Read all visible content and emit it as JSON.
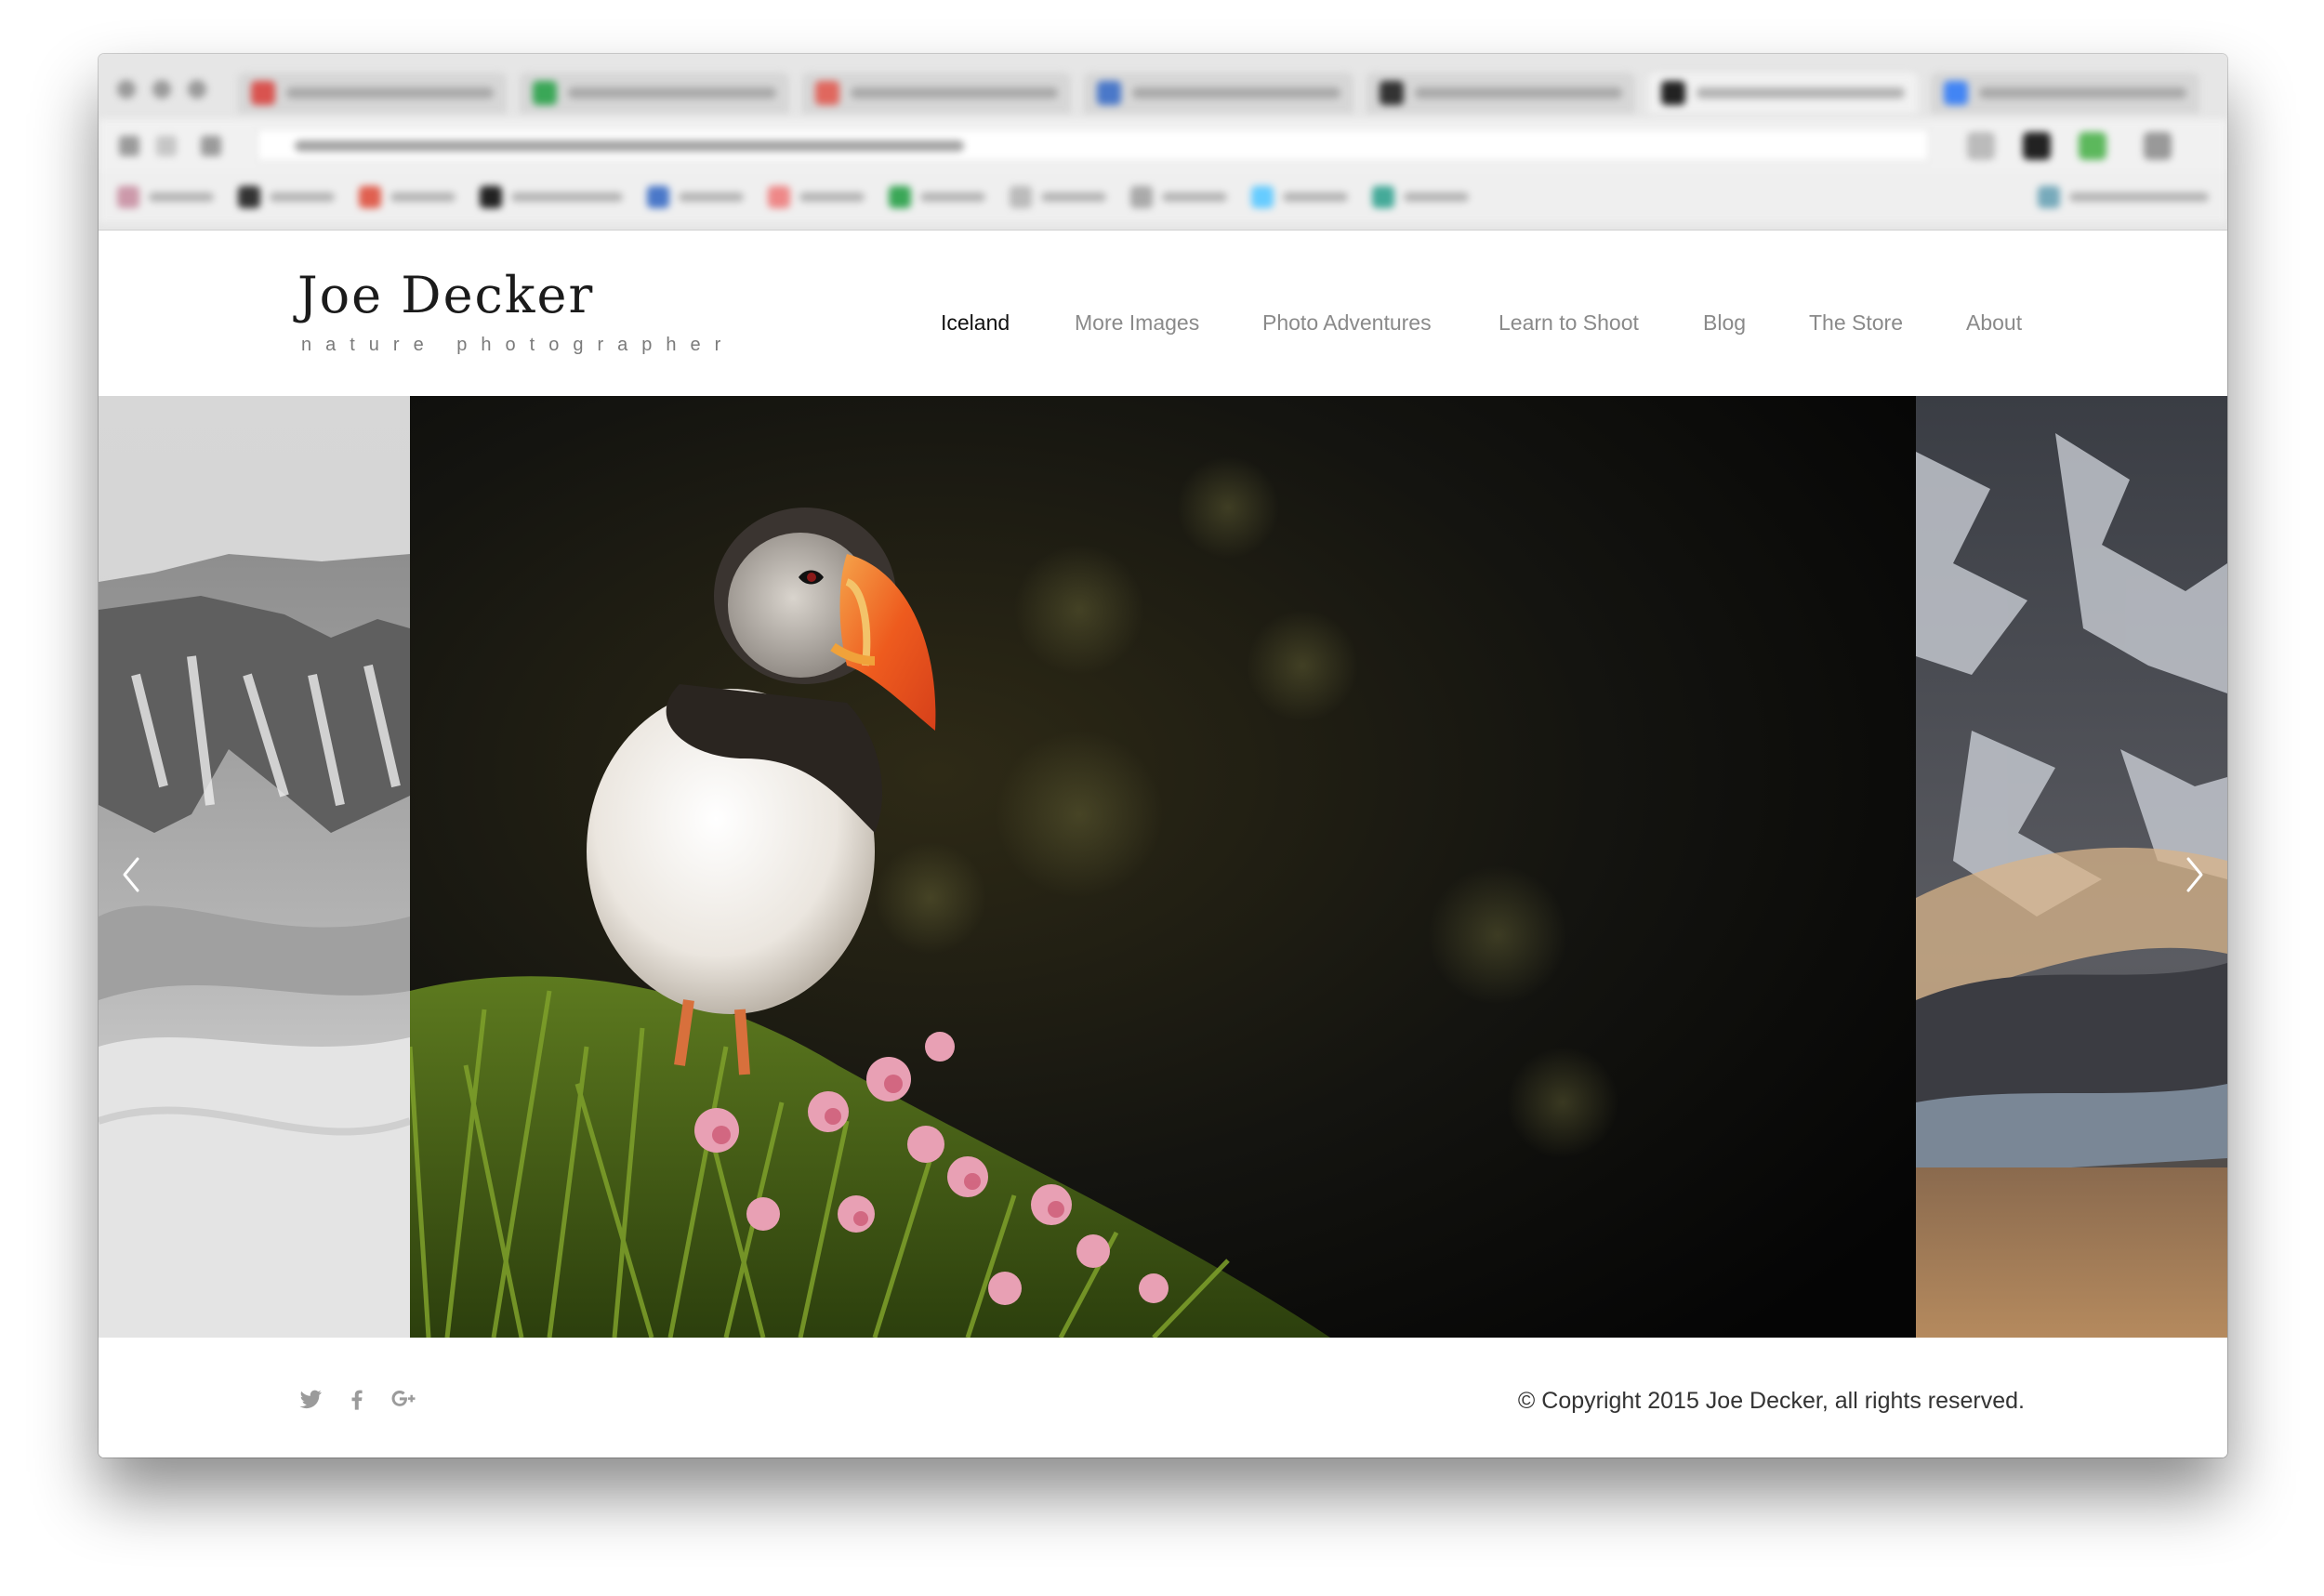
{
  "site": {
    "name": "Joe Decker",
    "tagline": "nature photographer"
  },
  "nav": {
    "items": [
      {
        "label": "Iceland",
        "active": true
      },
      {
        "label": "More Images",
        "active": false
      },
      {
        "label": "Photo Adventures",
        "active": false
      },
      {
        "label": "Learn to Shoot",
        "active": false
      },
      {
        "label": "Blog",
        "active": false
      },
      {
        "label": "The Store",
        "active": false
      },
      {
        "label": "About",
        "active": false
      }
    ]
  },
  "carousel": {
    "slides": [
      "glacier-landscape",
      "puffin",
      "snowy-mountain"
    ],
    "prev_icon": "chevron-left-icon",
    "next_icon": "chevron-right-icon"
  },
  "footer": {
    "social_icons": [
      "twitter-icon",
      "facebook-icon",
      "google-plus-icon"
    ],
    "copyright": "© Copyright 2015 Joe Decker, all rights reserved."
  },
  "colors": {
    "nav_active": "#111111",
    "nav_inactive": "#8a8a8a",
    "social_icon": "#9b9b9b",
    "text": "#333333"
  }
}
